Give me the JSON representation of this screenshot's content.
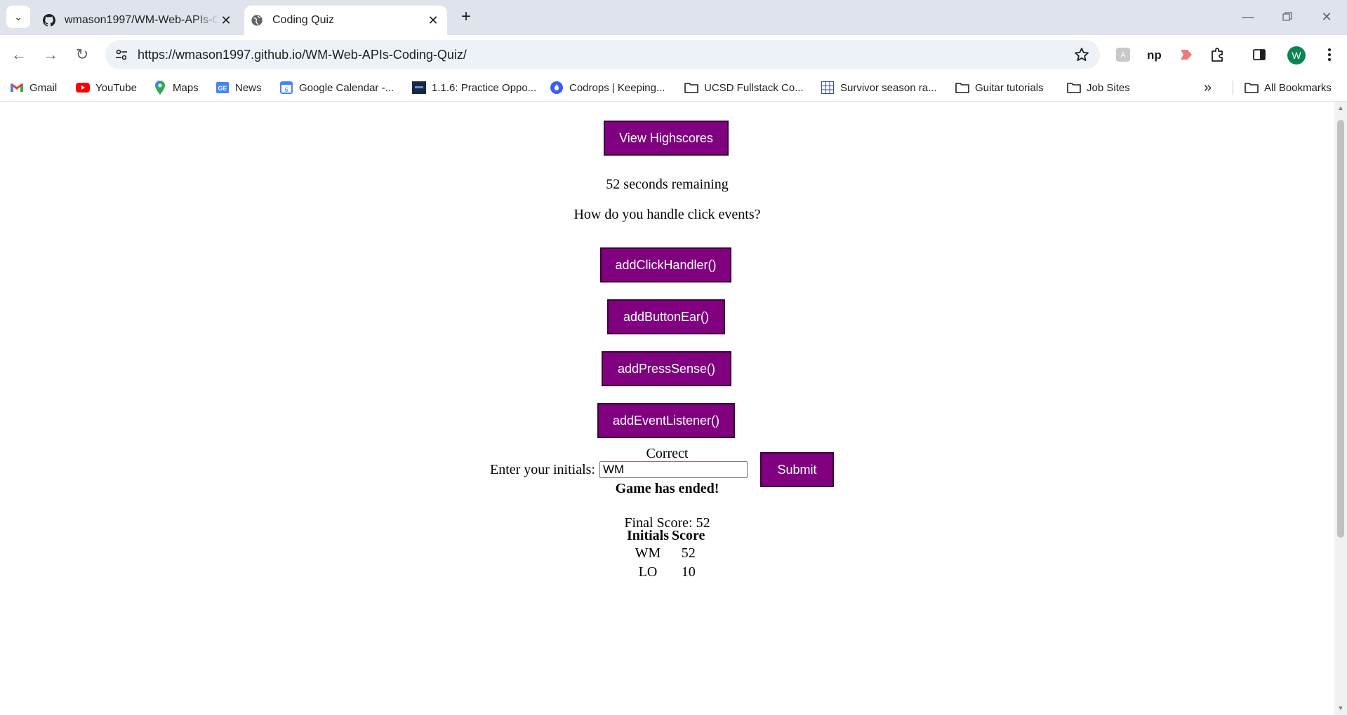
{
  "browser": {
    "tabs": [
      {
        "title": "wmason1997/WM-Web-APIs-Coding-Quiz",
        "favicon": "github-icon",
        "active": false
      },
      {
        "title": "Coding Quiz",
        "favicon": "globe-icon",
        "active": true
      }
    ],
    "url": "https://wmason1997.github.io/WM-Web-APIs-Coding-Quiz/",
    "profile_initial": "W",
    "bookmarks": [
      {
        "label": "Gmail",
        "icon": "gmail-icon"
      },
      {
        "label": "YouTube",
        "icon": "youtube-icon"
      },
      {
        "label": "Maps",
        "icon": "maps-icon"
      },
      {
        "label": "News",
        "icon": "news-icon"
      },
      {
        "label": "Google Calendar -...",
        "icon": "calendar-icon"
      },
      {
        "label": "1.1.6: Practice Oppo...",
        "icon": "site-icon"
      },
      {
        "label": "Codrops | Keeping...",
        "icon": "codrops-icon"
      },
      {
        "label": "UCSD Fullstack Co...",
        "icon": "folder-icon"
      },
      {
        "label": "Survivor season ra...",
        "icon": "grid-icon"
      },
      {
        "label": "Guitar tutorials",
        "icon": "folder-icon"
      },
      {
        "label": "Job Sites",
        "icon": "folder-icon"
      }
    ],
    "all_bookmarks": "All Bookmarks"
  },
  "quiz": {
    "highscores_button": "View Highscores",
    "timer_text": "52 seconds remaining",
    "question": "How do you handle click events?",
    "answers": [
      "addClickHandler()",
      "addButtonEar()",
      "addPressSense()",
      "addEventListener()"
    ],
    "feedback": "Correct",
    "game_over": "Game has ended!",
    "final_score": "Final Score: 52",
    "initials_label": "Enter your initials:",
    "initials_value": "WM",
    "submit_button": "Submit",
    "accent_color": "#800080"
  },
  "highscores": {
    "headers": [
      "Initials",
      "Score"
    ],
    "rows": [
      [
        "WM",
        "52"
      ],
      [
        "LO",
        "10"
      ]
    ]
  }
}
